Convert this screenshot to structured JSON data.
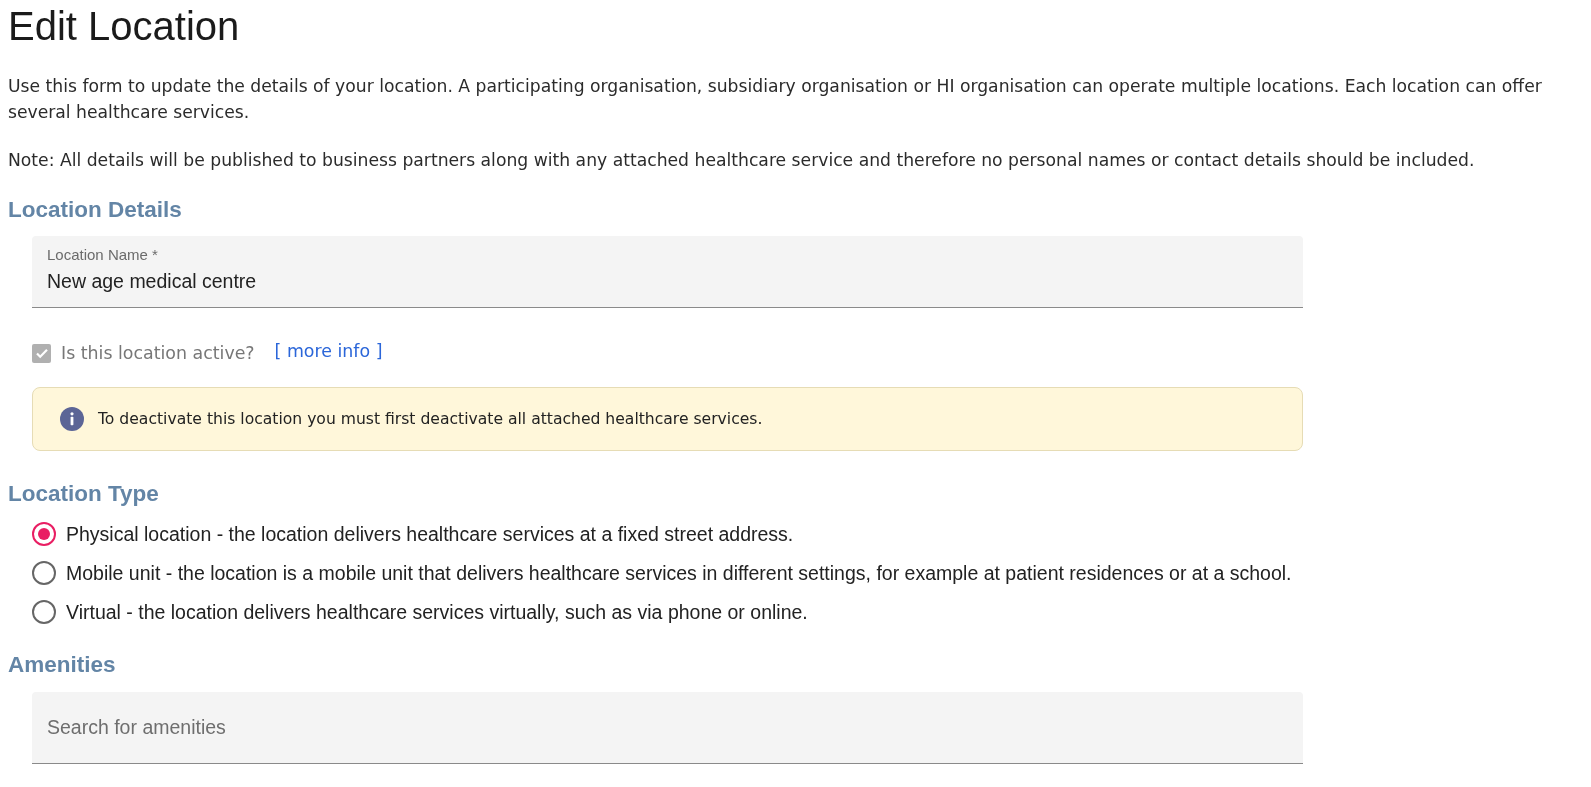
{
  "title": "Edit Location",
  "intro": [
    "Use this form to update the details of your location. A participating organisation, subsidiary organisation or HI organisation can operate multiple locations. Each location can offer several healthcare services.",
    "Note: All details will be published to business partners along with any attached healthcare service and therefore no personal names or contact details should be included."
  ],
  "location_details": {
    "heading": "Location Details",
    "name_field": {
      "label": "Location Name *",
      "value": "New age medical centre"
    },
    "active_checkbox": {
      "label": "Is this location active?",
      "checked": true,
      "disabled": true
    },
    "more_info_link": "[ more info ]",
    "alert": "To deactivate this location you must first deactivate all attached healthcare services."
  },
  "location_type": {
    "heading": "Location Type",
    "options": [
      {
        "label": "Physical location - the location delivers healthcare services at a fixed street address.",
        "selected": true
      },
      {
        "label": "Mobile unit - the location is a mobile unit that delivers healthcare services in different settings, for example at patient residences or at a school.",
        "selected": false
      },
      {
        "label": "Virtual - the location delivers healthcare services virtually, such as via phone or online.",
        "selected": false
      }
    ]
  },
  "amenities": {
    "heading": "Amenities",
    "search": {
      "placeholder": "Search for amenities"
    }
  }
}
